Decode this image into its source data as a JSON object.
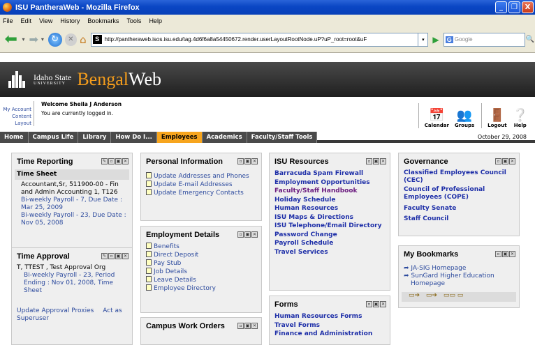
{
  "window": {
    "title": "ISU PantheraWeb - Mozilla Firefox",
    "controls": [
      "_",
      "❐",
      "X"
    ]
  },
  "menu": [
    "File",
    "Edit",
    "View",
    "History",
    "Bookmarks",
    "Tools",
    "Help"
  ],
  "nav": {
    "url": "http://pantheraweb.isos.isu.edu/tag.4d6f6a8a54450672.render.userLayoutRootNode.uP?uP_root=root&uF",
    "search_placeholder": "Google"
  },
  "banner": {
    "uni_line1": "Idaho State",
    "uni_line2": "UNIVERSITY",
    "brand_part1": "Bengal",
    "brand_part2": "Web"
  },
  "user": {
    "my_account": "My Account",
    "content_layout": "Content Layout",
    "welcome": "Welcome Sheila J Anderson",
    "status": "You are currently logged in."
  },
  "tools": [
    {
      "label": "Calendar",
      "icon": "calendar-icon"
    },
    {
      "label": "Groups",
      "icon": "groups-icon"
    },
    {
      "label": "Logout",
      "icon": "logout-icon"
    },
    {
      "label": "Help",
      "icon": "help-icon"
    }
  ],
  "tabs": [
    "Home",
    "Campus Life",
    "Library",
    "How Do I...",
    "Employees",
    "Academics",
    "Faculty/Staff Tools"
  ],
  "active_tab": "Employees",
  "date": "October 29, 2008",
  "portlets": {
    "time_reporting": {
      "title": "Time Reporting",
      "sub_head": "Time Sheet",
      "job": "Accountant,Sr, 511900-00 - Fin and Admin Accounting 1, T126",
      "link1": "Bi-weekly Payroll - 7, Due Date : Mar 25, 2009",
      "link2": "Bi-weekly Payroll - 23, Due Date : Nov 05, 2008"
    },
    "time_approval": {
      "title": "Time Approval",
      "org": "T, TTEST , Test Approval Org",
      "link": "Bi-weekly Payroll - 23, Period Ending : Nov 01, 2008, Time Sheet",
      "proxies": "Update Approval Proxies",
      "superuser": "Act as Superuser"
    },
    "personal_info": {
      "title": "Personal Information",
      "items": [
        "Update Addresses and Phones",
        "Update E-mail Addresses",
        "Update Emergency Contacts"
      ]
    },
    "employment_details": {
      "title": "Employment Details",
      "items": [
        "Benefits",
        "Direct Deposit",
        "Pay Stub",
        "Job Details",
        "Leave Details",
        "Employee Directory"
      ]
    },
    "campus_work_orders": {
      "title": "Campus Work Orders"
    },
    "isu_resources": {
      "title": "ISU Resources",
      "items": [
        "Barracuda Spam Firewall",
        "Employment Opportunities",
        "Faculty/Staff Handbook",
        "Holiday Schedule",
        "Human Resources",
        "ISU Maps & Directions",
        "ISU Telephone/Email Directory",
        "Password Change",
        "Payroll Schedule",
        "Travel Services"
      ]
    },
    "forms": {
      "title": "Forms",
      "items": [
        "Human Resources Forms",
        "Travel Forms",
        "Finance and Administration"
      ]
    },
    "governance": {
      "title": "Governance",
      "items": [
        "Classified Employees Council (CEC)",
        "Council of Professional Employees (COPE)",
        "Faculty Senate",
        "Staff Council"
      ]
    },
    "my_bookmarks": {
      "title": "My Bookmarks",
      "items": [
        "JA-SIG Homepage",
        "SunGard Higher Education Homepage"
      ]
    }
  }
}
